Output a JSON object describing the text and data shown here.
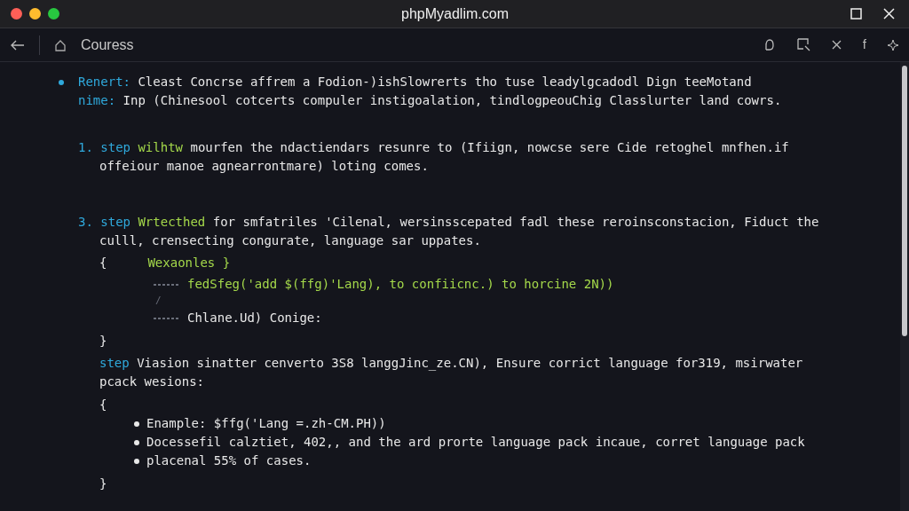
{
  "window": {
    "title": "phpMyadlim.com"
  },
  "toolbar": {
    "title": "Couress",
    "glyph": "f"
  },
  "content": [
    {
      "kind": "bullet",
      "lines": [
        [
          {
            "kind": "keyword",
            "text": "Renert:"
          },
          {
            "kind": "plain",
            "text": " Cleast Concrse affrem a Fodion-)ishSlowrerts tho tuse leadylgcadodl Dign teeMotand"
          }
        ],
        [
          {
            "kind": "keyword",
            "text": "nime:"
          },
          {
            "kind": "plain",
            "text": " Inp (Chinesool cotcerts compuler instigoalation, tindlogpeouChig Classlurter land cowrs."
          }
        ]
      ]
    },
    {
      "kind": "numbered",
      "number": "1.",
      "lines": [
        [
          {
            "kind": "keyword",
            "text": "step"
          },
          {
            "kind": "accent",
            "text": " wilhtw"
          },
          {
            "kind": "plain",
            "text": " mourfen the ndactiendars resunre to (Ifiign, nowcse sere Cide retoghel mnfhen.if"
          }
        ],
        [
          {
            "kind": "plain",
            "text": "offeiour manoe agnearrontmare) loting comes."
          }
        ]
      ]
    },
    {
      "kind": "numbered",
      "number": "3.",
      "lines": [
        [
          {
            "kind": "keyword",
            "text": "step"
          },
          {
            "kind": "accent",
            "text": " Wrtecthed"
          },
          {
            "kind": "plain",
            "text": " for smfatriles 'Cilenal, wersinsscepated fadl these reroinsconstacion, Fiduct the"
          }
        ],
        [
          {
            "kind": "plain",
            "text": "culll, crensecting congurate, language sar uppates."
          }
        ]
      ],
      "children": [
        {
          "kind": "brace",
          "open": "{",
          "lines": [
            [
              {
                "kind": "accent",
                "text": "Wexaonles }"
              }
            ]
          ],
          "children": [
            {
              "kind": "arrow",
              "text": "fedSfeg('add $(ffg)'Lang), to confiicnc.) to horcine 2N))",
              "accent": true
            },
            {
              "kind": "mark",
              "text": "/"
            },
            {
              "kind": "arrow",
              "text": "Chlane.Ud) Conige:",
              "accent": false
            }
          ]
        },
        {
          "kind": "close",
          "text": "}"
        },
        {
          "kind": "paragraph",
          "lines": [
            [
              {
                "kind": "keyword",
                "text": "step"
              },
              {
                "kind": "plain",
                "text": " Viasion sinatter cenverto 3S8 langgJinc_ze.CN), Ensure corrict language for319, msirwater"
              }
            ],
            [
              {
                "kind": "plain",
                "text": "pcack wesions:"
              }
            ]
          ]
        },
        {
          "kind": "close",
          "text": "{"
        },
        {
          "kind": "dot",
          "text": "Enample: $ffg('Lang =.zh-CM.PH))"
        },
        {
          "kind": "dot",
          "text": "Docessefil calztiet, 402,, and the ard prorte language pack incaue, corret language pack"
        },
        {
          "kind": "dot",
          "text": "placenal 55% of cases."
        },
        {
          "kind": "close",
          "text": "}"
        }
      ]
    }
  ]
}
